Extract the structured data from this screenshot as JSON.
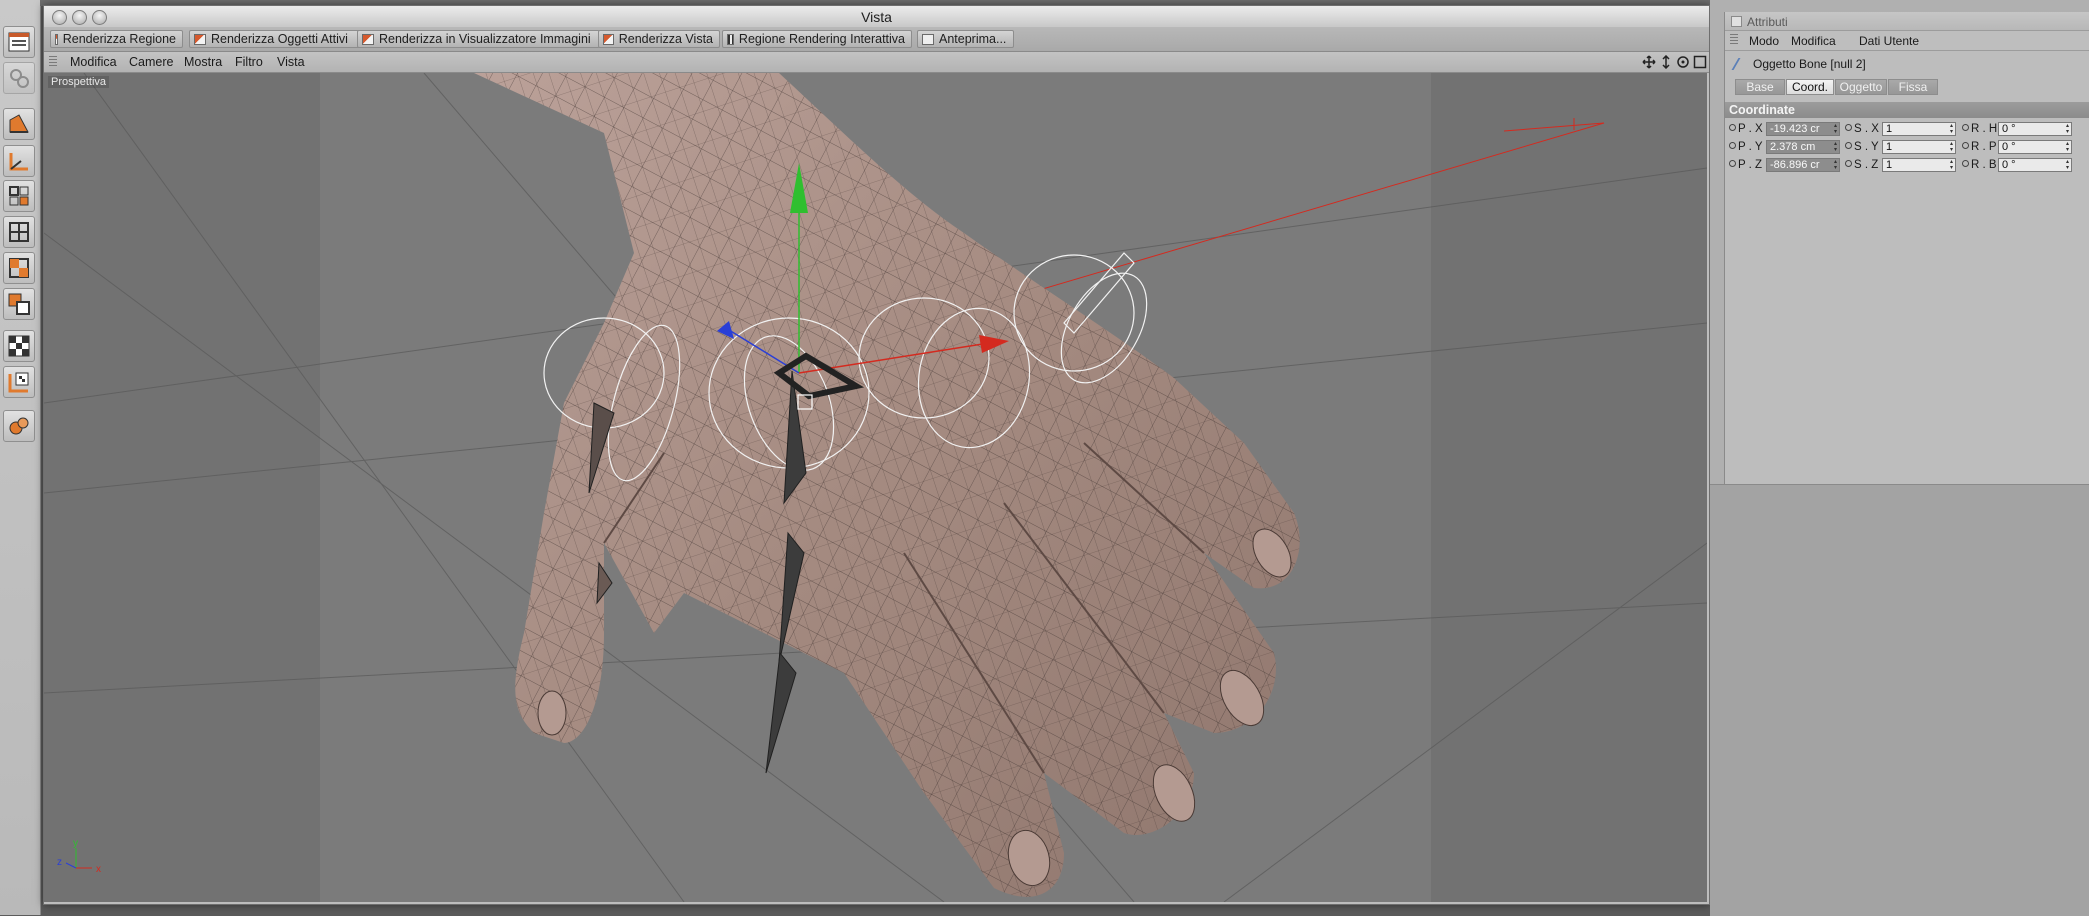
{
  "vista_window": {
    "title": "Vista",
    "render_buttons": [
      {
        "label": "Renderizza Regione"
      },
      {
        "label": "Renderizza Oggetti Attivi"
      },
      {
        "label": "Renderizza in Visualizzatore Immagini"
      },
      {
        "label": "Renderizza Vista"
      },
      {
        "label": "Regione Rendering Interattiva"
      },
      {
        "label": "Anteprima..."
      }
    ],
    "menu": [
      "Modifica",
      "Camere",
      "Mostra",
      "Filtro",
      "Vista"
    ],
    "viewport_label": "Prospettiva",
    "axis_labels": {
      "x": "x",
      "y": "y",
      "z": "z"
    }
  },
  "attributes": {
    "title": "Attributi",
    "menu": [
      "Modo",
      "Modifica",
      "Dati Utente"
    ],
    "object": "Oggetto Bone [null 2]",
    "tabs": [
      "Base",
      "Coord.",
      "Oggetto",
      "Fissa"
    ],
    "active_tab": "Coord.",
    "section": "Coordinate",
    "rows": [
      {
        "p_label": "P . X",
        "p_value": "-19.423 cr",
        "s_label": "S . X",
        "s_value": "1",
        "r_label": "R . H",
        "r_value": "0 °"
      },
      {
        "p_label": "P . Y",
        "p_value": "2.378 cm",
        "s_label": "S . Y",
        "s_value": "1",
        "r_label": "R . P",
        "r_value": "0 °"
      },
      {
        "p_label": "P . Z",
        "p_value": "-86.896 cr",
        "s_label": "S . Z",
        "s_value": "1",
        "r_label": "R . B",
        "r_value": "0 °"
      }
    ]
  },
  "tool_icons": [
    "view-layout-icon",
    "live-selection-icon",
    "scale-tool-icon",
    "rotate-axis-icon",
    "model-mode-icon",
    "object-mode-icon",
    "points-mode-icon",
    "polygons-mode-icon",
    "texture-mode-icon",
    "uv-mode-icon",
    "workplane-icon",
    "sculpt-icon"
  ],
  "colors": {
    "x_axis": "#d42a1f",
    "y_axis": "#2fbf2f",
    "z_axis": "#2a3fd6",
    "skin": "#a48a80"
  }
}
